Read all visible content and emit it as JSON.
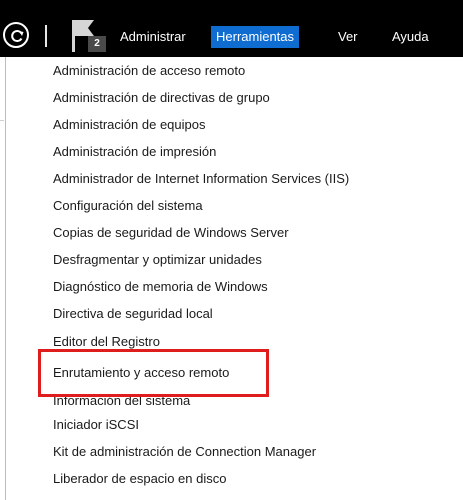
{
  "menubar": {
    "flag_badge": "2",
    "items": [
      {
        "label": "Administrar"
      },
      {
        "label": "Herramientas",
        "active": true
      },
      {
        "label": "Ver"
      },
      {
        "label": "Ayuda"
      }
    ]
  },
  "tools_menu": {
    "items": [
      {
        "label": "Administración de acceso remoto"
      },
      {
        "label": "Administración de directivas de grupo"
      },
      {
        "label": "Administración de equipos"
      },
      {
        "label": "Administración de impresión"
      },
      {
        "label": "Administrador de Internet Information Services (IIS)"
      },
      {
        "label": "Configuración del sistema"
      },
      {
        "label": "Copias de seguridad de Windows Server"
      },
      {
        "label": "Desfragmentar y optimizar unidades"
      },
      {
        "label": "Diagnóstico de memoria de Windows"
      },
      {
        "label": "Directiva de seguridad local"
      },
      {
        "label": "Editor del Registro"
      },
      {
        "label": "Enrutamiento y acceso remoto",
        "highlighted": true
      },
      {
        "label": "Información del sistema"
      },
      {
        "label": "Iniciador iSCSI"
      },
      {
        "label": "Kit de administración de Connection Manager"
      },
      {
        "label": "Liberador de espacio en disco"
      }
    ]
  },
  "colors": {
    "menubar_bg": "#000000",
    "active_menu_bg": "#0f6cd1",
    "highlight_border": "#e01d1d"
  }
}
